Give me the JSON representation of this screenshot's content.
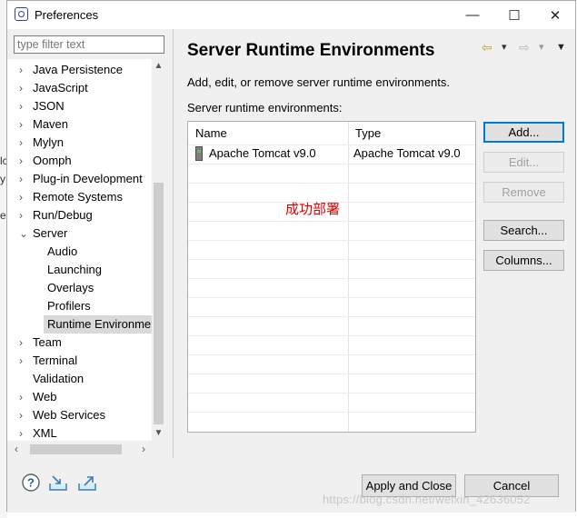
{
  "window": {
    "title": "Preferences",
    "controls": [
      "—",
      "☐",
      "✕"
    ]
  },
  "filter": {
    "placeholder": "type filter text"
  },
  "tree": [
    {
      "label": "Java Persistence",
      "arrow": "›",
      "level": 0
    },
    {
      "label": "JavaScript",
      "arrow": "›",
      "level": 0
    },
    {
      "label": "JSON",
      "arrow": "›",
      "level": 0
    },
    {
      "label": "Maven",
      "arrow": "›",
      "level": 0
    },
    {
      "label": "Mylyn",
      "arrow": "›",
      "level": 0
    },
    {
      "label": "Oomph",
      "arrow": "›",
      "level": 0
    },
    {
      "label": "Plug-in Development",
      "arrow": "›",
      "level": 0
    },
    {
      "label": "Remote Systems",
      "arrow": "›",
      "level": 0
    },
    {
      "label": "Run/Debug",
      "arrow": "›",
      "level": 0
    },
    {
      "label": "Server",
      "arrow": "⌄",
      "level": 0
    },
    {
      "label": "Audio",
      "arrow": "",
      "level": 1
    },
    {
      "label": "Launching",
      "arrow": "",
      "level": 1
    },
    {
      "label": "Overlays",
      "arrow": "",
      "level": 1
    },
    {
      "label": "Profilers",
      "arrow": "",
      "level": 1
    },
    {
      "label": "Runtime Environme",
      "arrow": "",
      "level": 1,
      "selected": true
    },
    {
      "label": "Team",
      "arrow": "›",
      "level": 0
    },
    {
      "label": "Terminal",
      "arrow": "›",
      "level": 0
    },
    {
      "label": "Validation",
      "arrow": "",
      "level": 0
    },
    {
      "label": "Web",
      "arrow": "›",
      "level": 0
    },
    {
      "label": "Web Services",
      "arrow": "›",
      "level": 0
    },
    {
      "label": "XML",
      "arrow": "›",
      "level": 0
    }
  ],
  "page": {
    "title": "Server Runtime Environments",
    "description": "Add, edit, or remove server runtime environments.",
    "list_label": "Server runtime environments:",
    "nav": {
      "back": "⇦",
      "back_menu": "▾",
      "forward": "⇨",
      "forward_menu": "▾",
      "view_menu": "▼"
    }
  },
  "table": {
    "columns": [
      "Name",
      "Type"
    ],
    "rows": [
      {
        "name": "Apache Tomcat v9.0",
        "type": "Apache Tomcat v9.0"
      }
    ]
  },
  "annotation": "成功部署",
  "buttons": {
    "add": "Add...",
    "edit": "Edit...",
    "remove": "Remove",
    "search": "Search...",
    "columns": "Columns..."
  },
  "footer": {
    "apply_close": "Apply and Close",
    "cancel": "Cancel"
  },
  "watermark": "https://blog.csdn.net/weixin_42636052",
  "background_chars": [
    "lc",
    "y",
    "er"
  ],
  "colors": {
    "accent": "#0078d7",
    "annotation": "#e00000"
  }
}
